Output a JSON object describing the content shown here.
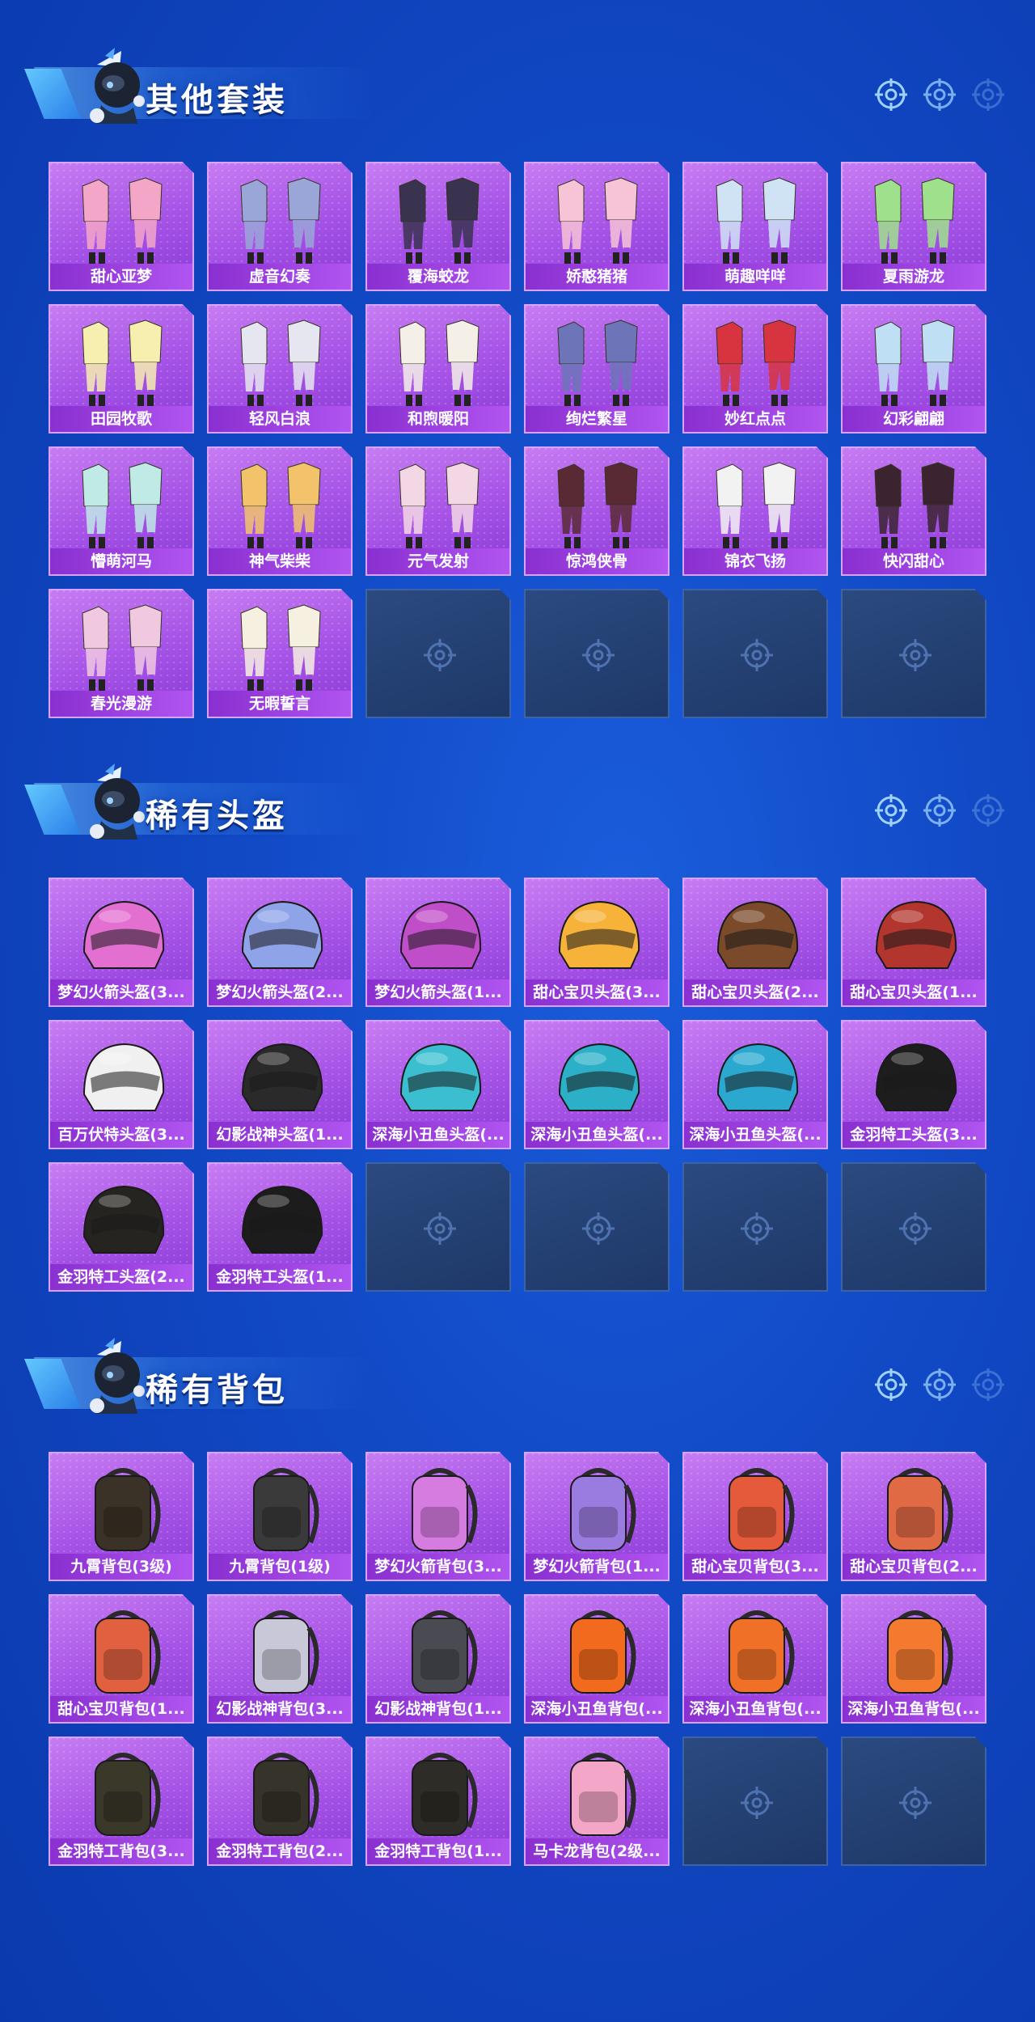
{
  "colors": {
    "background": "#1148c4",
    "card_purple": "#a552e6",
    "card_label": "#8a2fd0",
    "empty_slot": "#1e3868",
    "title_text": "#ffffff"
  },
  "sections": [
    {
      "title": "其他套装",
      "icon": "mascot-icon",
      "category": "outfit",
      "items": [
        "甜心亚梦",
        "虚音幻奏",
        "覆海蛟龙",
        "娇憨猪猪",
        "萌趣咩咩",
        "夏雨游龙",
        "田园牧歌",
        "轻风白浪",
        "和煦暖阳",
        "绚烂繁星",
        "妙红点点",
        "幻彩翩翩",
        "懵萌河马",
        "神气柴柴",
        "元气发射",
        "惊鸿侠骨",
        "锦衣飞扬",
        "快闪甜心",
        "春光漫游",
        "无暇誓言"
      ],
      "empty_slots": 4
    },
    {
      "title": "稀有头盔",
      "icon": "mascot-icon",
      "category": "helmet",
      "items": [
        "梦幻火箭头盔(3...",
        "梦幻火箭头盔(2...",
        "梦幻火箭头盔(1...",
        "甜心宝贝头盔(3...",
        "甜心宝贝头盔(2...",
        "甜心宝贝头盔(1...",
        "百万伏特头盔(3...",
        "幻影战神头盔(1...",
        "深海小丑鱼头盔(...",
        "深海小丑鱼头盔(...",
        "深海小丑鱼头盔(...",
        "金羽特工头盔(3...",
        "金羽特工头盔(2...",
        "金羽特工头盔(1..."
      ],
      "empty_slots": 4
    },
    {
      "title": "稀有背包",
      "icon": "mascot-icon",
      "category": "backpack",
      "items": [
        "九霄背包(3级)",
        "九霄背包(1级)",
        "梦幻火箭背包(3...",
        "梦幻火箭背包(1...",
        "甜心宝贝背包(3...",
        "甜心宝贝背包(2...",
        "甜心宝贝背包(1...",
        "幻影战神背包(3...",
        "幻影战神背包(1...",
        "深海小丑鱼背包(...",
        "深海小丑鱼背包(...",
        "深海小丑鱼背包(...",
        "金羽特工背包(3...",
        "金羽特工背包(2...",
        "金羽特工背包(1...",
        "马卡龙背包(2级..."
      ],
      "empty_slots": 2
    }
  ]
}
